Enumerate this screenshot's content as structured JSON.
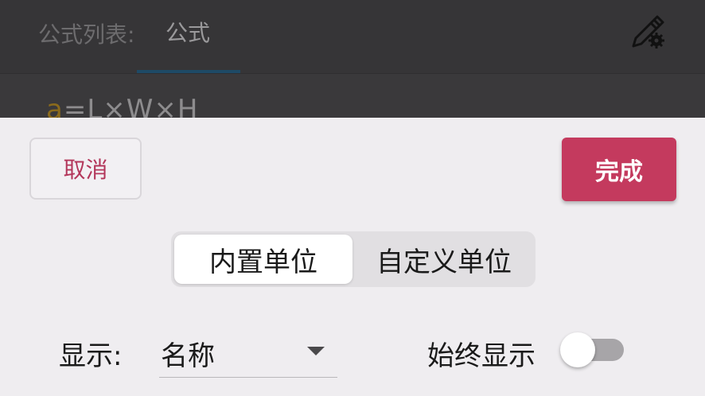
{
  "header": {
    "list_label": "公式列表:",
    "active_tab": "公式",
    "edit_icon": "edit-settings-icon"
  },
  "content": {
    "formula_prefix": "a",
    "formula_rest": "=L×W×H"
  },
  "sheet": {
    "cancel_label": "取消",
    "done_label": "完成",
    "segments": [
      "内置单位",
      "自定义单位"
    ],
    "selected_segment": "内置单位",
    "display_label": "显示:",
    "display_value": "名称",
    "always_show_label": "始终显示",
    "always_show_on": false
  },
  "colors": {
    "accent": "#c43a5e",
    "sheet_bg": "#efedf0",
    "tab_underline": "#1e4a66"
  }
}
